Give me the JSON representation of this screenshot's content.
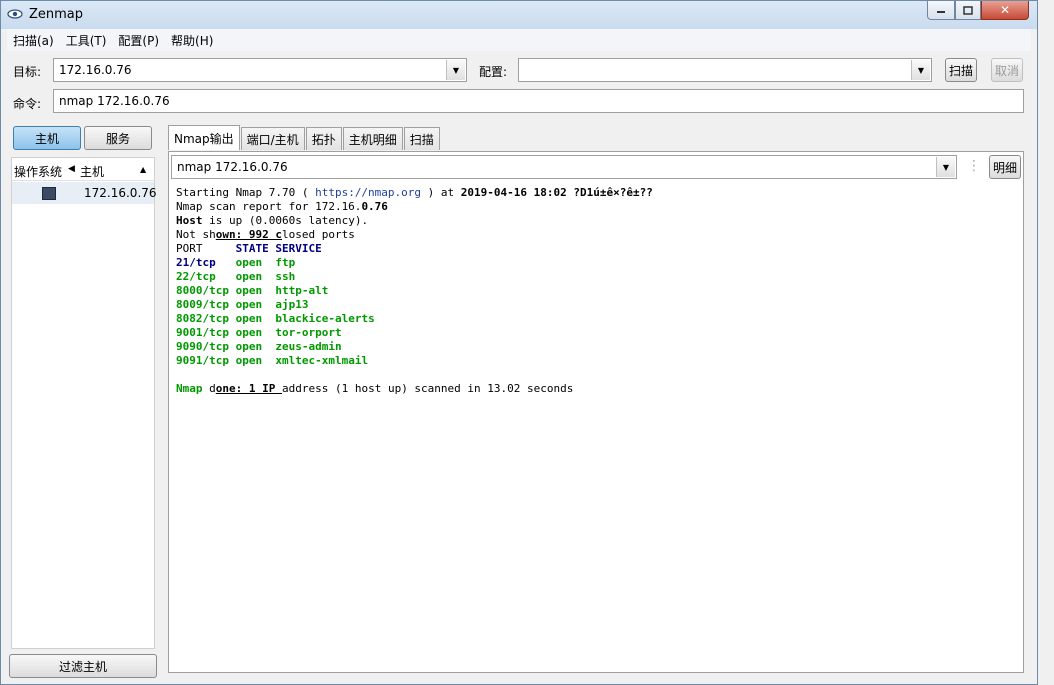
{
  "window": {
    "title": "Zenmap"
  },
  "menu": [
    "扫描(a)",
    "工具(T)",
    "配置(P)",
    "帮助(H)"
  ],
  "target": {
    "label": "目标:",
    "value": "172.16.0.76"
  },
  "profile": {
    "label": "配置:",
    "value": ""
  },
  "buttons": {
    "scan": "扫描",
    "cancel": "取消",
    "hosts": "主机",
    "services": "服务",
    "details": "明细",
    "filter": "过滤主机"
  },
  "command": {
    "label": "命令:",
    "value": "nmap 172.16.0.76"
  },
  "hostlist": {
    "col_os": "操作系统",
    "col_host": "主机",
    "hosts": [
      "172.16.0.76"
    ]
  },
  "tabs": [
    "Nmap输出",
    "端口/主机",
    "拓扑",
    "主机明细",
    "扫描"
  ],
  "output_select": "nmap 172.16.0.76",
  "output": {
    "line1_prefix": "Starting Nmap 7.70 ( ",
    "line1_url": "https://nmap.org",
    "line1_mid": " ) at ",
    "line1_date": "2019-04-16 18:02",
    "line1_suffix": " ?D1ú±ê×?ê±??",
    "line2_prefix": "Nmap scan report for 172.16.",
    "line2_bold": "0.76",
    "line3_bold": "Host",
    "line3_rest": " is up (0.0060s latency).",
    "line4_a": "Not sh",
    "line4_ul": "own: 992 c",
    "line4_b": "losed ports",
    "header_port": "PORT     ",
    "header_rest": "STATE SERVICE",
    "ports": [
      {
        "port": "21/tcp",
        "pad": "   ",
        "state": "open",
        "service": "ftp",
        "port_style": "navy"
      },
      {
        "port": "22/tcp",
        "pad": "   ",
        "state": "open",
        "service": "ssh",
        "port_style": "green"
      },
      {
        "port": "8000/tcp",
        "pad": " ",
        "state": "open",
        "service": "http-alt",
        "port_style": "green"
      },
      {
        "port": "8009/tcp",
        "pad": " ",
        "state": "open",
        "service": "ajp13",
        "port_style": "green"
      },
      {
        "port": "8082/tcp",
        "pad": " ",
        "state": "open",
        "service": "blackice-alerts",
        "port_style": "green"
      },
      {
        "port": "9001/tcp",
        "pad": " ",
        "state": "open",
        "service": "tor-orport",
        "port_style": "green"
      },
      {
        "port": "9090/tcp",
        "pad": " ",
        "state": "open",
        "service": "zeus-admin",
        "port_style": "green"
      },
      {
        "port": "9091/tcp",
        "pad": " ",
        "state": "open",
        "service": "xmltec-xmlmail",
        "port_style": "green"
      }
    ],
    "done_green": "Nmap",
    "done_a": " d",
    "done_ul": "one: 1 IP ",
    "done_b": "address (1 host up) scanned in 13.02 seconds"
  }
}
